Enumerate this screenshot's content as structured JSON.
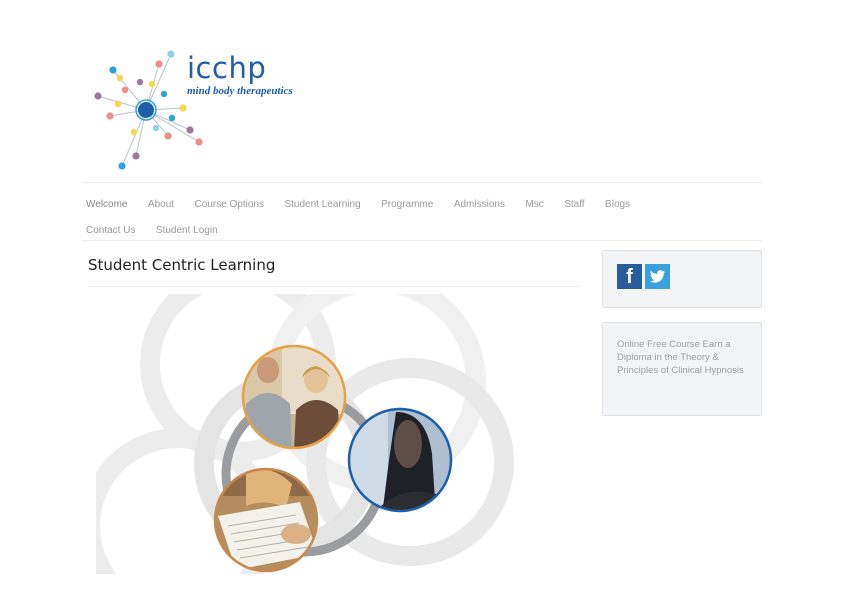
{
  "brand": {
    "name": "icchp",
    "tagline": "mind body therapeutics"
  },
  "nav": {
    "items": [
      "Welcome",
      "About",
      "Course Options",
      "Student Learning",
      "Programme",
      "Admissions",
      "Msc",
      "Staff",
      "Blogs",
      "Contact Us",
      "Student Login"
    ],
    "active": "Welcome"
  },
  "main": {
    "title": "Student Centric Learning"
  },
  "sidebar": {
    "social": {
      "facebook_glyph": "f",
      "facebook_icon": "facebook-icon",
      "twitter_icon": "twitter-icon"
    },
    "promo_text": "Online Free Course Earn a Diploma in the Theory & Principles of Clinical Hypnosis"
  },
  "colors": {
    "brand_blue": "#1e5fa8",
    "photo_ring_orange": "#e8a046",
    "photo_ring_blue": "#1e5fa8",
    "photo_ring_brown": "#c58a4c",
    "facebook": "#2a5b9a",
    "twitter": "#3aa0dc"
  }
}
